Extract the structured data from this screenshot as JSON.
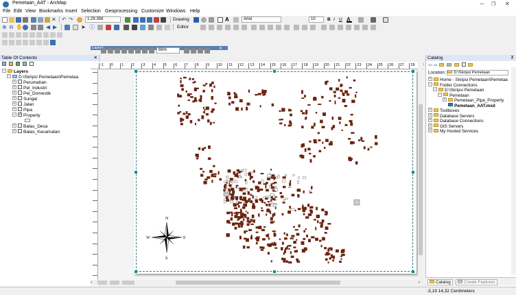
{
  "app": {
    "title": "Pemetaan_AAT - ArcMap",
    "window_controls": [
      "–",
      "❐",
      "✕"
    ]
  },
  "menu": [
    "File",
    "Edit",
    "View",
    "Bookmarks",
    "Insert",
    "Selection",
    "Geoprocessing",
    "Customize",
    "Windows",
    "Help"
  ],
  "toolbar": {
    "scale": "1:29.358",
    "drawing_label": "Drawing",
    "font_name": "Arial",
    "font_size": "10",
    "bold": "B",
    "italic": "I",
    "underline": "U",
    "editor_label": "Editor",
    "zoom": "66%",
    "layout_tab": "Layout"
  },
  "toc": {
    "title": "Table Of Contents",
    "layers_label": "Layers",
    "path": "D:\\Skripsi Pemetaan\\Pemetaa",
    "layers": [
      {
        "name": "Perumahan",
        "checked": false,
        "expanded": false
      },
      {
        "name": "Pel_Industri",
        "checked": false,
        "expanded": false
      },
      {
        "name": "Pel_Domestik",
        "checked": false,
        "expanded": false
      },
      {
        "name": "Sungai",
        "checked": false,
        "expanded": false
      },
      {
        "name": "Jalan",
        "checked": false,
        "expanded": false
      },
      {
        "name": "Pipa",
        "checked": false,
        "expanded": false
      },
      {
        "name": "Property",
        "checked": true,
        "expanded": true
      },
      {
        "name": "Batas_Desa",
        "checked": false,
        "expanded": false
      },
      {
        "name": "Batas_Kecamatan",
        "checked": false,
        "expanded": false
      }
    ]
  },
  "layout": {
    "ruler_ticks": [
      "-1",
      "0",
      "1",
      "2",
      "3",
      "4",
      "5",
      "6",
      "7",
      "8",
      "9",
      "10",
      "11",
      "12",
      "13",
      "14",
      "15",
      "16",
      "17",
      "18",
      "19",
      "20",
      "21",
      "22",
      "23",
      "24",
      "25",
      "26",
      "27",
      "28",
      "29"
    ],
    "north_arrow": {
      "n": "N",
      "s": "S",
      "e": "E",
      "w": "W"
    }
  },
  "catalog": {
    "title": "Catalog",
    "location_label": "Location:",
    "location_value": "D:\\Skripsi Pemetaan",
    "items": [
      {
        "label": "Home - Skripsi Pemetaan\\Pemetaa",
        "indent": 0,
        "sign": "⊞",
        "bold": false
      },
      {
        "label": "Folder Connections",
        "indent": 0,
        "sign": "⊟",
        "bold": false
      },
      {
        "label": "D:\\Skripsi Pemetaan",
        "indent": 1,
        "sign": "⊟",
        "bold": false
      },
      {
        "label": "Pemetaan",
        "indent": 2,
        "sign": "⊟",
        "bold": false
      },
      {
        "label": "Pemetaan_Pipa_Property.",
        "indent": 3,
        "sign": "⊞",
        "bold": false
      },
      {
        "label": "Pemetaan_AAT.mxd",
        "indent": 3,
        "sign": "",
        "bold": true
      },
      {
        "label": "Toolboxes",
        "indent": 0,
        "sign": "⊞",
        "bold": false
      },
      {
        "label": "Database Servers",
        "indent": 0,
        "sign": "⊞",
        "bold": false
      },
      {
        "label": "Database Connections",
        "indent": 0,
        "sign": "⊞",
        "bold": false
      },
      {
        "label": "GIS Servers",
        "indent": 0,
        "sign": "⊞",
        "bold": false
      },
      {
        "label": "My Hosted Services",
        "indent": 0,
        "sign": "⊞",
        "bold": false
      }
    ],
    "tabs": [
      "Catalog",
      "Create Features"
    ]
  },
  "status": {
    "coords": "-3,19  14,32 Centimeters"
  },
  "colors": {
    "parcel": "#6b2410",
    "accent": "#1c8b8b",
    "header": "#dce6f4"
  }
}
